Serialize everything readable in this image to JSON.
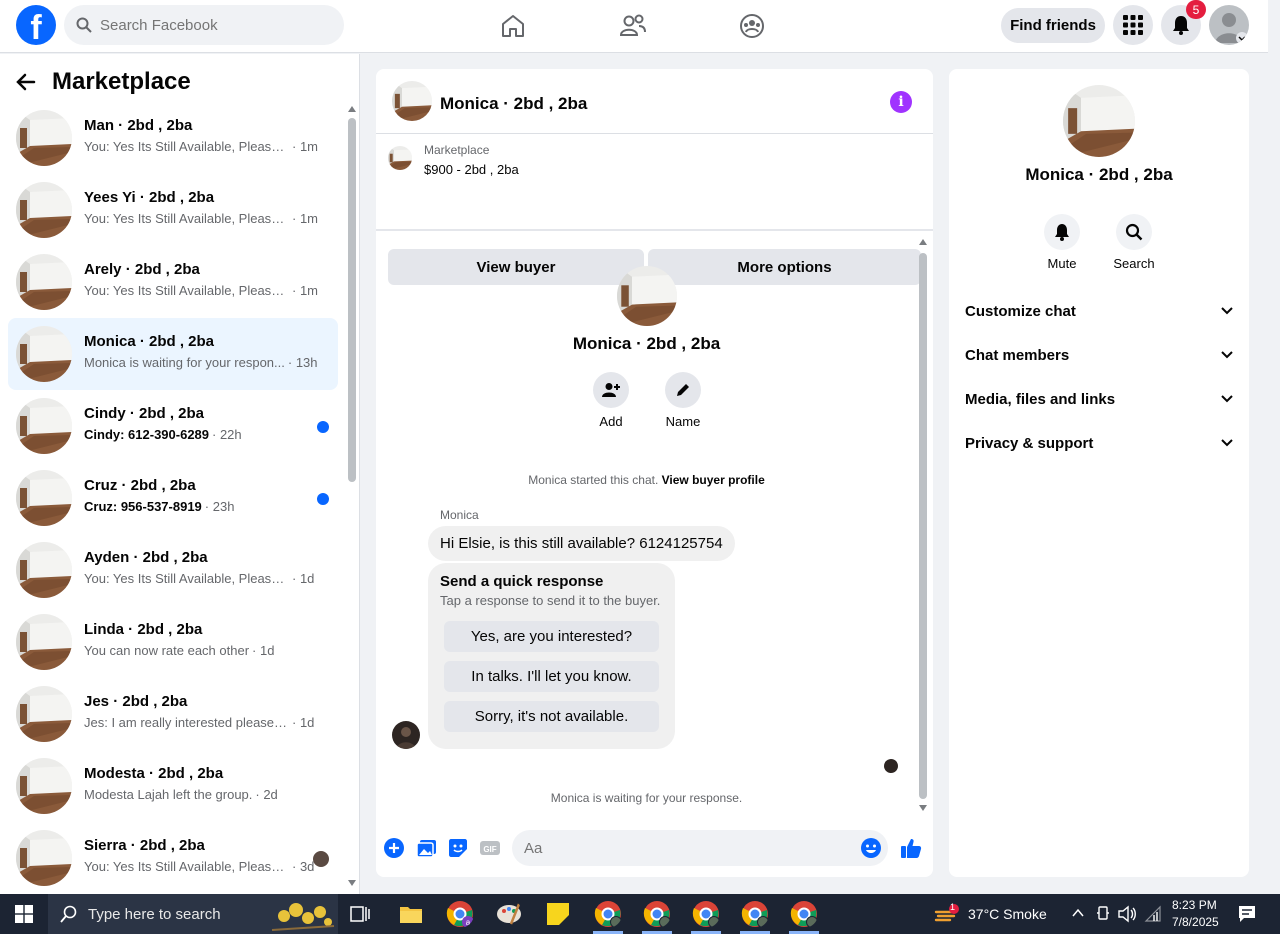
{
  "topbar": {
    "logo": "f",
    "search_placeholder": "Search Facebook",
    "find_friends": "Find friends",
    "notif_count": "5"
  },
  "sidebar": {
    "title": "Marketplace",
    "items": [
      {
        "name": "Man · 2bd , 2ba",
        "preview": "You: Yes Its Still Available, Please S...",
        "time": "· 1m",
        "unread": false
      },
      {
        "name": "Yees Yi · 2bd , 2ba",
        "preview": "You: Yes Its Still Available, Please S...",
        "time": "· 1m",
        "unread": false
      },
      {
        "name": "Arely · 2bd , 2ba",
        "preview": "You: Yes Its Still Available, Please S...",
        "time": "· 1m",
        "unread": false
      },
      {
        "name": "Monica · 2bd , 2ba",
        "preview": "Monica is waiting for your respon...",
        "time": "· 13h",
        "unread": false,
        "active": true
      },
      {
        "name": "Cindy · 2bd , 2ba",
        "preview": "Cindy: 612-390-6289",
        "time": "· 22h",
        "unread": true
      },
      {
        "name": "Cruz · 2bd , 2ba",
        "preview": "Cruz: 956-537-8919",
        "time": "· 23h",
        "unread": true
      },
      {
        "name": "Ayden · 2bd , 2ba",
        "preview": "You: Yes Its Still Available, Please Se...",
        "time": "· 1d",
        "unread": false
      },
      {
        "name": "Linda · 2bd , 2ba",
        "preview": "You can now rate each other",
        "time": "· 1d",
        "unread": false
      },
      {
        "name": "Jes · 2bd , 2ba",
        "preview": "Jes: I am really interested please let...",
        "time": "· 1d",
        "unread": false
      },
      {
        "name": "Modesta · 2bd , 2ba",
        "preview": "Modesta Lajah left the group.",
        "time": "· 2d",
        "unread": false
      },
      {
        "name": "Sierra · 2bd , 2ba",
        "preview": "You: Yes Its Still Available, Please...",
        "time": "· 3d",
        "unread": false
      }
    ]
  },
  "chat": {
    "title": "Monica · 2bd , 2ba",
    "listing_label": "Marketplace",
    "listing_price": "$900 - 2bd , 2ba",
    "view_buyer": "View buyer",
    "more_options": "More options",
    "center_name": "Monica · 2bd , 2ba",
    "add_label": "Add",
    "name_label": "Name",
    "started_text": "Monica started this chat.",
    "view_buyer_profile": "View buyer profile",
    "sender": "Monica",
    "message": "Hi Elsie, is this still available? 6124125754",
    "quick_title": "Send a quick response",
    "quick_sub": "Tap a response to send it to the buyer.",
    "quick_options": [
      "Yes, are you interested?",
      "In talks. I'll let you know.",
      "Sorry, it's not available."
    ],
    "waiting": "Monica is waiting for your response.",
    "composer_placeholder": "Aa"
  },
  "info": {
    "name": "Monica · 2bd , 2ba",
    "mute": "Mute",
    "search": "Search",
    "sections": [
      "Customize chat",
      "Chat members",
      "Media, files and links",
      "Privacy & support"
    ]
  },
  "taskbar": {
    "search_placeholder": "Type here to search",
    "weather": "37°C  Smoke",
    "weather_badge": "1",
    "time": "8:23 PM",
    "date": "7/8/2025"
  },
  "colors": {
    "brand": "#0866ff",
    "accent_purple": "#a033ff",
    "unread_dot": "#0866ff",
    "active_bg": "#ebf5ff"
  }
}
